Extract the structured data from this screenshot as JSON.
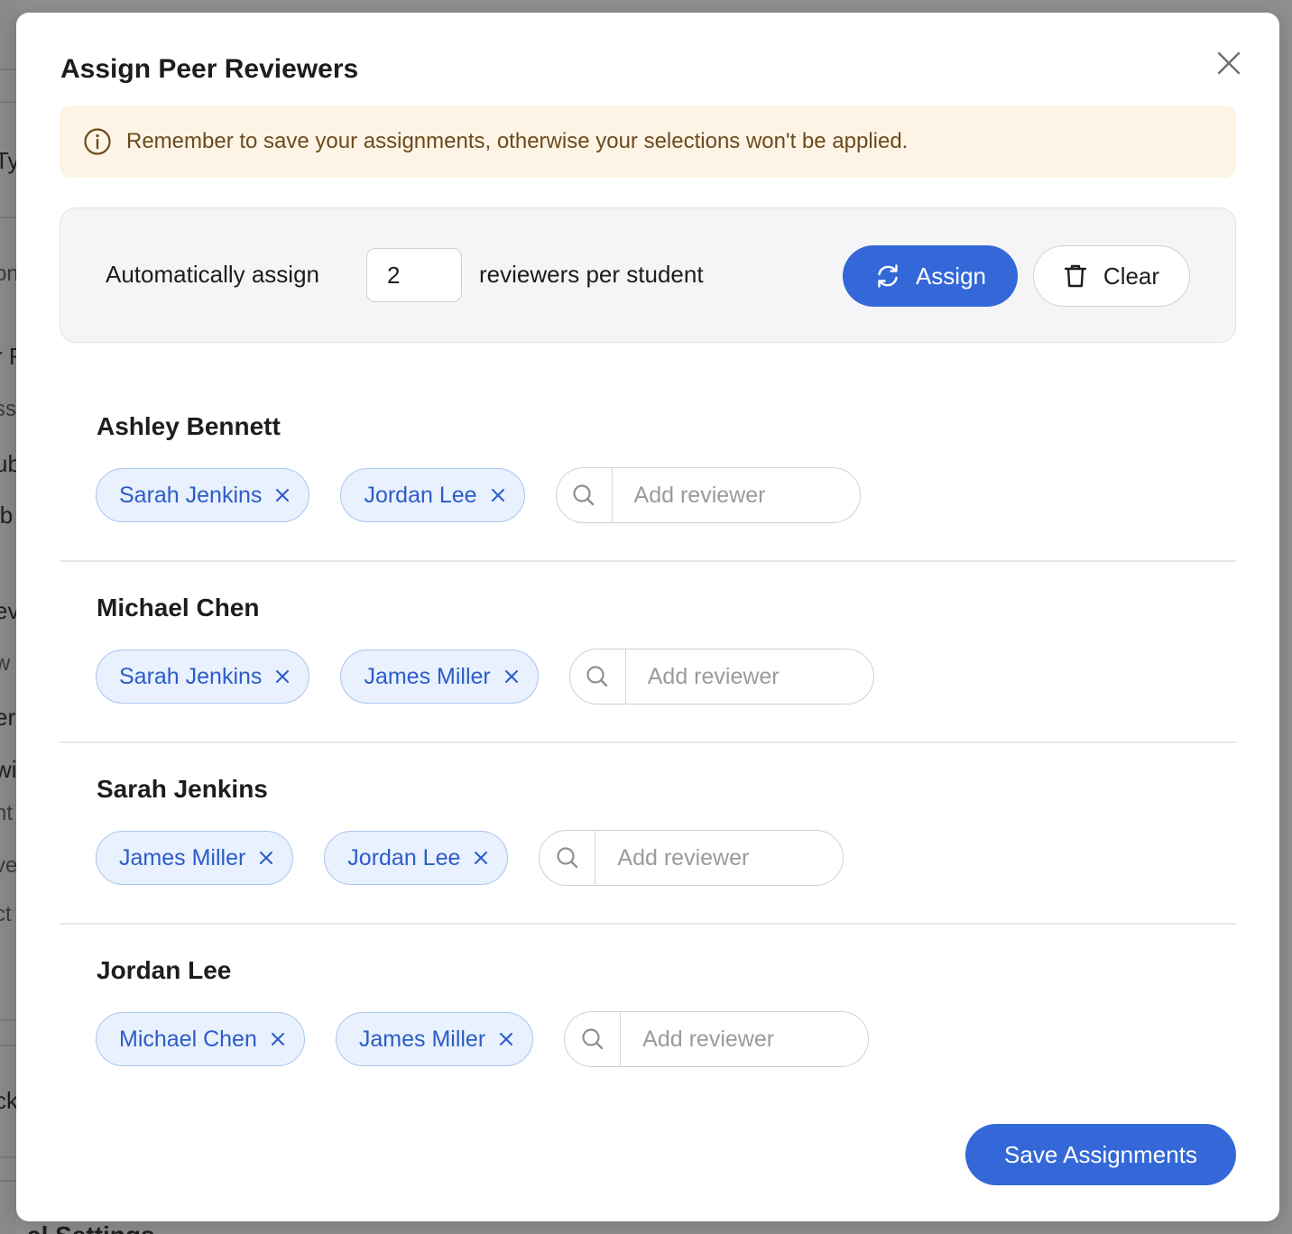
{
  "background": {
    "fragments": [
      "Ty",
      "on",
      "r R",
      "ss",
      "ub",
      "ib",
      "ev",
      "w",
      "er-",
      "wi",
      "nt",
      "ve",
      "ct",
      "ck"
    ],
    "bottom_text": "al Settings"
  },
  "modal": {
    "title": "Assign Peer Reviewers",
    "close_icon": "close-icon",
    "notice": {
      "icon": "info-circle-icon",
      "text": "Remember to save your assignments, otherwise your selections won't be applied."
    },
    "auto_assign": {
      "label": "Automatically assign",
      "count": "2",
      "suffix": "reviewers per student",
      "assign_label": "Assign",
      "assign_icon": "refresh-icon",
      "clear_label": "Clear",
      "clear_icon": "trash-icon"
    },
    "add_placeholder": "Add reviewer",
    "students": [
      {
        "name": "Ashley Bennett",
        "reviewers": [
          "Sarah Jenkins",
          "Jordan Lee"
        ]
      },
      {
        "name": "Michael Chen",
        "reviewers": [
          "Sarah Jenkins",
          "James Miller"
        ]
      },
      {
        "name": "Sarah Jenkins",
        "reviewers": [
          "James Miller",
          "Jordan Lee"
        ]
      },
      {
        "name": "Jordan Lee",
        "reviewers": [
          "Michael Chen",
          "James Miller"
        ]
      }
    ],
    "save_label": "Save Assignments"
  },
  "colors": {
    "primary": "#3468d8",
    "chip_bg": "#e8f1fd",
    "chip_text": "#2d5cc8",
    "notice_bg": "#fdf4e6",
    "notice_text": "#6b4a1c"
  }
}
